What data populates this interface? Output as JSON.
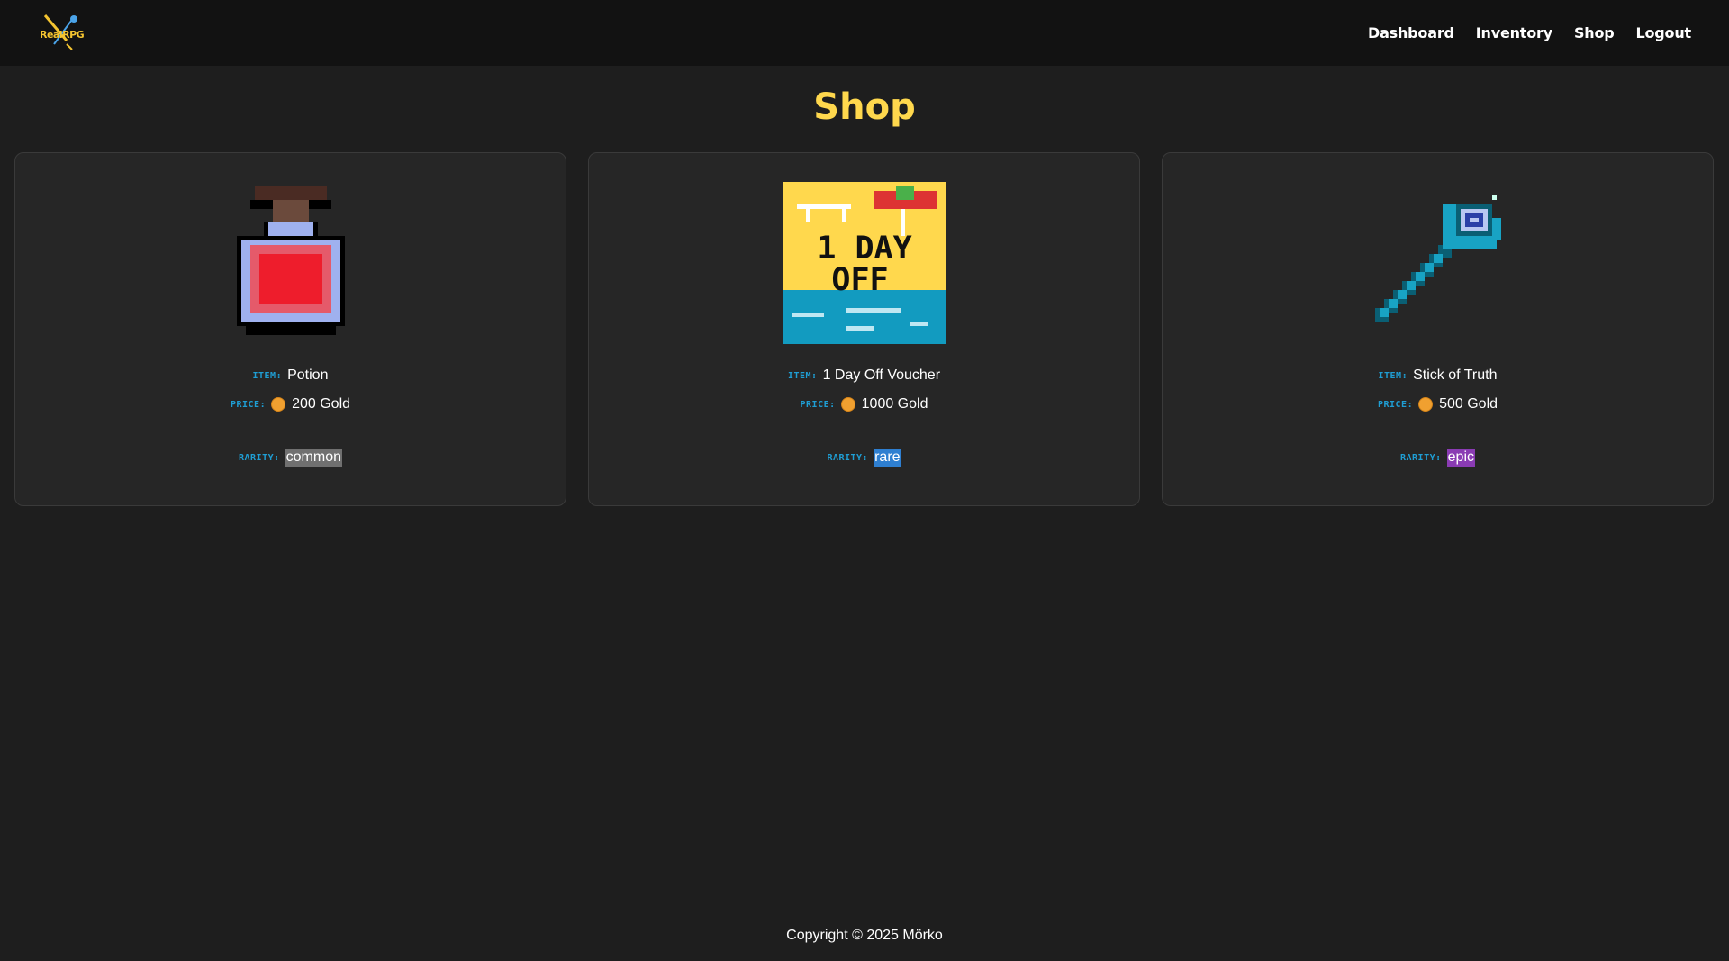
{
  "brand": {
    "logo_text": "RealRPG"
  },
  "nav": {
    "items": [
      {
        "label": "Dashboard"
      },
      {
        "label": "Inventory"
      },
      {
        "label": "Shop"
      },
      {
        "label": "Logout"
      }
    ]
  },
  "page": {
    "title": "Shop"
  },
  "labels": {
    "item": "ITEM:",
    "price": "PRICE:",
    "rarity": "RARITY:"
  },
  "items": [
    {
      "name": "Potion",
      "price": "200 Gold",
      "rarity": "common",
      "icon": "potion-icon"
    },
    {
      "name": "1 Day Off Voucher",
      "price": "1000 Gold",
      "rarity": "rare",
      "icon": "day-off-voucher-icon",
      "image_text": {
        "line1": "1 DAY",
        "line2": "OFF"
      }
    },
    {
      "name": "Stick of Truth",
      "price": "500 Gold",
      "rarity": "epic",
      "icon": "staff-icon"
    }
  ],
  "colors": {
    "title": "#ffd84d",
    "label": "#1f9ed4",
    "common": "#707070",
    "rare": "#2e7fd1",
    "epic": "#8a3bb3",
    "coin": "#f0a030"
  },
  "footer": {
    "copyright": "Copyright © 2025 Mörko"
  }
}
